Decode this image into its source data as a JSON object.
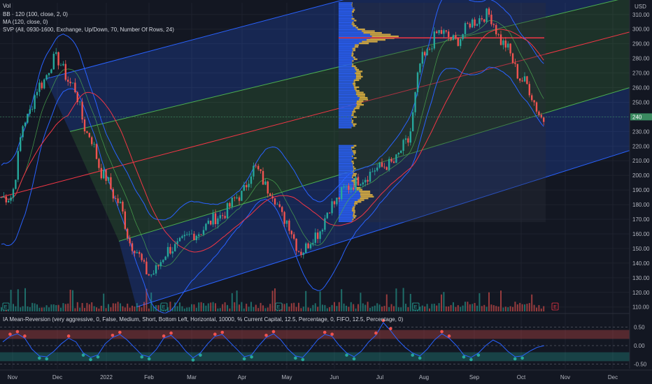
{
  "legend": {
    "vol": "Vol",
    "bb": "BB · 120 (100, close, 2, 0)",
    "ma": "MA (120, close, 0)",
    "svp": "SVP (All, 0930-1600, Exchange, Up/Down, 70, Number Of Rows, 24)",
    "strategy": "IA Mean-Reversion (very aggressive, 0, False, Medium, Short, Bottom Left, Horizontal, 10000, % Current Capital, 12.5, Percentage, 0, FIFO, 12.5, Percentage, 0)"
  },
  "currency_label": "USD",
  "last_price_tag": "240",
  "earnings_marker": "E",
  "colors": {
    "background": "#131722",
    "up": "#26a69a",
    "down": "#ef5350",
    "channel_blue": "#2962ff",
    "channel_green": "#4caf50",
    "median_red": "#f23645",
    "ma_line": "#f23645",
    "bb_line": "#2962ff",
    "profile_blue": "#2962ff",
    "profile_gold": "#f5c242",
    "poc": "#f23645"
  },
  "chart_data": [
    {
      "type": "line",
      "title": "",
      "x_tick_labels": [
        "Nov",
        "Dec",
        "2022",
        "Feb",
        "Mar",
        "Apr",
        "May",
        "Jun",
        "Jul",
        "Aug",
        "Sep",
        "Oct",
        "Nov",
        "Dec"
      ],
      "y_tick_labels": [
        "310.00",
        "300.00",
        "290.00",
        "280.00",
        "270.00",
        "260.00",
        "250.00",
        "240.00",
        "230.00",
        "220.00",
        "210.00",
        "200.00",
        "190.00",
        "180.00",
        "170.00",
        "160.00",
        "150.00",
        "140.00",
        "130.00",
        "120.00",
        "110.00"
      ],
      "ylim": [
        107,
        318
      ],
      "series": [
        {
          "x": [
            "Nov",
            "Nov",
            "Nov",
            "Dec",
            "Dec",
            "Dec",
            "2022",
            "2022",
            "2022",
            "Feb",
            "Feb",
            "Mar",
            "Mar",
            "Apr",
            "Apr",
            "Apr",
            "May",
            "May",
            "May",
            "Jun",
            "Jun",
            "Jun",
            "Jul",
            "Jul",
            "Jul",
            "Aug",
            "Aug",
            "Aug",
            "Sep",
            "Sep",
            "Sep",
            "Oct",
            "Oct"
          ],
          "values": [
            185,
            238,
            262,
            280,
            262,
            228,
            200,
            182,
            152,
            132,
            150,
            160,
            172,
            186,
            205,
            190,
            170,
            148,
            160,
            180,
            192,
            198,
            205,
            208,
            222,
            280,
            298,
            292,
            305,
            310,
            290,
            265,
            238
          ]
        }
      ],
      "volume_profile_poc": 294,
      "last_price": 240
    },
    {
      "type": "line",
      "title": "",
      "y_tick_labels": [
        "0.50",
        "0.00",
        "-0.50"
      ],
      "ylim": [
        -0.62,
        0.62
      ],
      "bands": [
        [
          0.18,
          0.42
        ],
        [
          -0.42,
          -0.18
        ]
      ],
      "series": [
        {
          "values": [
            0.1,
            0.25,
            0.32,
            0.2,
            -0.1,
            -0.28,
            -0.3,
            -0.15,
            0.05,
            0.2,
            0.1,
            -0.2,
            -0.32,
            -0.25,
            0.05,
            0.22,
            0.3,
            0.15,
            -0.05,
            -0.25,
            -0.3,
            -0.1,
            0.2,
            0.28,
            0.1,
            -0.15,
            -0.33,
            -0.2,
            0.05,
            0.25,
            0.3,
            0.1,
            -0.1,
            -0.3,
            -0.25,
            0.0,
            0.22,
            0.32,
            0.15,
            -0.1,
            -0.28,
            -0.32,
            -0.1,
            0.15,
            0.3,
            0.25,
            0.0,
            -0.2,
            -0.3,
            -0.15,
            0.1,
            0.28,
            0.62,
            0.4,
            0.15,
            -0.05,
            -0.2,
            -0.28,
            -0.1,
            0.15,
            0.32,
            0.2,
            0.0,
            -0.25,
            -0.32,
            -0.2,
            0.0,
            0.15,
            0.05,
            -0.15,
            -0.3,
            -0.28,
            -0.15,
            -0.05,
            0.0
          ]
        }
      ]
    }
  ]
}
